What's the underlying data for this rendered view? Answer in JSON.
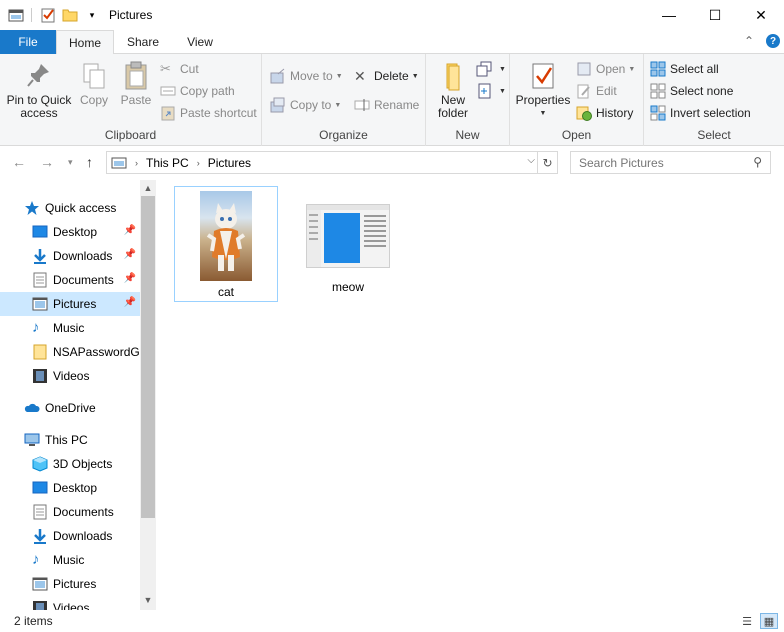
{
  "window": {
    "title": "Pictures",
    "minimize_glyph": "—",
    "maximize_glyph": "☐",
    "close_glyph": "✕"
  },
  "ribbon_tabs": [
    {
      "label": "File"
    },
    {
      "label": "Home"
    },
    {
      "label": "Share"
    },
    {
      "label": "View"
    }
  ],
  "ribbon": {
    "clipboard": {
      "label": "Clipboard",
      "pin": "Pin to Quick access",
      "copy": "Copy",
      "paste": "Paste",
      "cut": "Cut",
      "copy_path": "Copy path",
      "paste_shortcut": "Paste shortcut"
    },
    "organize": {
      "label": "Organize",
      "move_to": "Move to",
      "copy_to": "Copy to",
      "delete": "Delete",
      "rename": "Rename"
    },
    "new": {
      "label": "New",
      "new_folder": "New folder"
    },
    "open": {
      "label": "Open",
      "properties": "Properties",
      "open": "Open",
      "edit": "Edit",
      "history": "History"
    },
    "select": {
      "label": "Select",
      "select_all": "Select all",
      "select_none": "Select none",
      "invert": "Invert selection"
    }
  },
  "address": {
    "segments": [
      "This PC",
      "Pictures"
    ],
    "search_placeholder": "Search Pictures"
  },
  "sidebar": {
    "items": [
      {
        "label": "Quick access",
        "icon": "star-icon",
        "level": 0
      },
      {
        "label": "Desktop",
        "icon": "desktop-icon",
        "level": 1,
        "pinned": true
      },
      {
        "label": "Downloads",
        "icon": "download-icon",
        "level": 1,
        "pinned": true
      },
      {
        "label": "Documents",
        "icon": "document-icon",
        "level": 1,
        "pinned": true
      },
      {
        "label": "Pictures",
        "icon": "pictures-icon",
        "level": 1,
        "pinned": true,
        "selected": true
      },
      {
        "label": "Music",
        "icon": "music-icon",
        "level": 1
      },
      {
        "label": "NSAPasswordGu",
        "icon": "folder-icon",
        "level": 1
      },
      {
        "label": "Videos",
        "icon": "video-icon",
        "level": 1
      },
      {
        "label": "OneDrive",
        "icon": "cloud-icon",
        "level": 0
      },
      {
        "label": "This PC",
        "icon": "computer-icon",
        "level": 0
      },
      {
        "label": "3D Objects",
        "icon": "cube-icon",
        "level": 1
      },
      {
        "label": "Desktop",
        "icon": "desktop-icon",
        "level": 1
      },
      {
        "label": "Documents",
        "icon": "document-icon",
        "level": 1
      },
      {
        "label": "Downloads",
        "icon": "download-icon",
        "level": 1
      },
      {
        "label": "Music",
        "icon": "music-icon",
        "level": 1
      },
      {
        "label": "Pictures",
        "icon": "pictures-icon",
        "level": 1
      },
      {
        "label": "Videos",
        "icon": "video-icon",
        "level": 1
      }
    ]
  },
  "files": [
    {
      "name": "cat",
      "selected": true
    },
    {
      "name": "meow",
      "selected": false
    }
  ],
  "status": {
    "item_count": "2 items"
  },
  "colors": {
    "accent": "#1979ca",
    "selection": "#cce8ff",
    "ribbon_bg": "#f5f6f7"
  }
}
